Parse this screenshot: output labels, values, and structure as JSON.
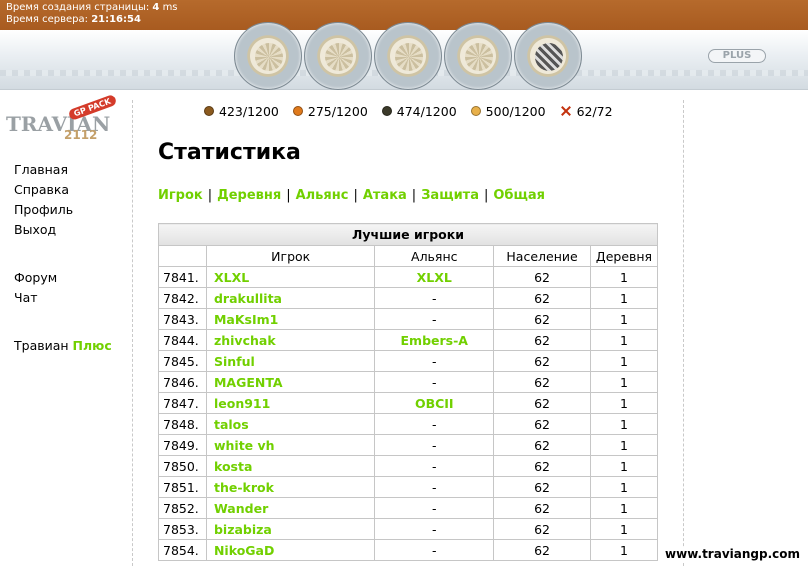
{
  "top": {
    "gen_label": "Время создания страницы:",
    "gen_value": "4",
    "gen_unit": "ms",
    "server_label": "Время сервера:",
    "server_time": "21:16:54",
    "plus_label": "PLUS"
  },
  "logo": {
    "word": "TRAVIAN",
    "year": "2112",
    "badge": "GP PACK"
  },
  "leftnav": {
    "items": [
      "Главная",
      "Справка",
      "Профиль",
      "Выход"
    ],
    "items2": [
      "Форум",
      "Чат"
    ],
    "plus_prefix": "Травиан",
    "plus_word": "Плюс"
  },
  "resources": [
    {
      "name": "wood-icon",
      "value": "423/1200",
      "color": "#8b5a1e"
    },
    {
      "name": "clay-icon",
      "value": "275/1200",
      "color": "#e07a1c"
    },
    {
      "name": "iron-icon",
      "value": "474/1200",
      "color": "#3b3a2a"
    },
    {
      "name": "crop-icon",
      "value": "500/1200",
      "color": "#e8b04a"
    },
    {
      "name": "consumption-icon",
      "value": "62/72",
      "color": "#c3320e"
    }
  ],
  "page": {
    "title": "Статистика"
  },
  "tabs": [
    "Игрок",
    "Деревня",
    "Альянс",
    "Атака",
    "Защита",
    "Общая"
  ],
  "table": {
    "caption": "Лучшие игроки",
    "headers": [
      "",
      "Игрок",
      "Альянс",
      "Население",
      "Деревня"
    ],
    "rows": [
      {
        "rank": "7841.",
        "player": "XLXL",
        "ally": "XLXL",
        "pop": "62",
        "vil": "1"
      },
      {
        "rank": "7842.",
        "player": "drakullita",
        "ally": "-",
        "pop": "62",
        "vil": "1"
      },
      {
        "rank": "7843.",
        "player": "MaKsIm1",
        "ally": "-",
        "pop": "62",
        "vil": "1"
      },
      {
        "rank": "7844.",
        "player": "zhivchak",
        "ally": "Embers-A",
        "pop": "62",
        "vil": "1"
      },
      {
        "rank": "7845.",
        "player": "Sinful",
        "ally": "-",
        "pop": "62",
        "vil": "1"
      },
      {
        "rank": "7846.",
        "player": "MAGENTA",
        "ally": "-",
        "pop": "62",
        "vil": "1"
      },
      {
        "rank": "7847.",
        "player": "leon911",
        "ally": "OBCII",
        "pop": "62",
        "vil": "1"
      },
      {
        "rank": "7848.",
        "player": "talos",
        "ally": "-",
        "pop": "62",
        "vil": "1"
      },
      {
        "rank": "7849.",
        "player": "white vh",
        "ally": "-",
        "pop": "62",
        "vil": "1"
      },
      {
        "rank": "7850.",
        "player": "kosta",
        "ally": "-",
        "pop": "62",
        "vil": "1"
      },
      {
        "rank": "7851.",
        "player": "the-krok",
        "ally": "-",
        "pop": "62",
        "vil": "1"
      },
      {
        "rank": "7852.",
        "player": "Wander",
        "ally": "-",
        "pop": "62",
        "vil": "1"
      },
      {
        "rank": "7853.",
        "player": "bizabiza",
        "ally": "-",
        "pop": "62",
        "vil": "1"
      },
      {
        "rank": "7854.",
        "player": "NikoGaD",
        "ally": "-",
        "pop": "62",
        "vil": "1"
      }
    ]
  },
  "watermark": "www.traviangp.com"
}
